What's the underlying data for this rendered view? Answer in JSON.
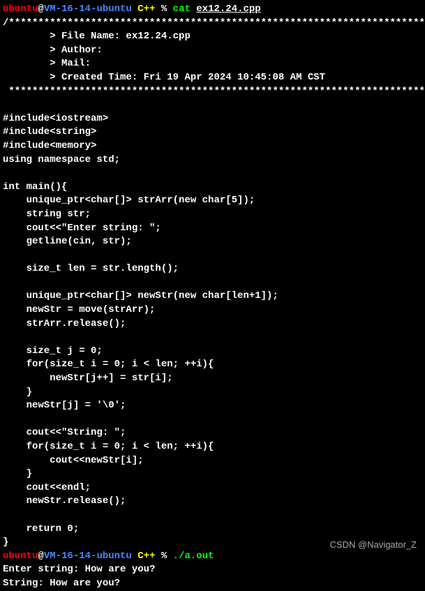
{
  "prompt1": {
    "user": "ubuntu",
    "at": "@",
    "host": "VM-16-14-ubuntu",
    "dir": " C++",
    "pct": " %",
    "cmd": " cat ",
    "file": "ex12.24.cpp"
  },
  "header": {
    "open": "/*************************************************************************",
    "file_line": "        > File Name: ex12.24.cpp",
    "author_line": "        > Author: ",
    "mail_line": "        > Mail: ",
    "created_line": "        > Created Time: Fri 19 Apr 2024 10:45:08 AM CST",
    "close": " ************************************************************************/"
  },
  "code": {
    "l1": "#include<iostream>",
    "l2": "#include<string>",
    "l3": "#include<memory>",
    "l4": "using namespace std;",
    "l5": "int main(){",
    "l6": "    unique_ptr<char[]> strArr(new char[5]);",
    "l7": "    string str;",
    "l8": "    cout<<\"Enter string: \";",
    "l9": "    getline(cin, str);",
    "l10": "    size_t len = str.length();",
    "l11": "    unique_ptr<char[]> newStr(new char[len+1]);",
    "l12": "    newStr = move(strArr);",
    "l13": "    strArr.release();",
    "l14": "    size_t j = 0;",
    "l15": "    for(size_t i = 0; i < len; ++i){",
    "l16": "        newStr[j++] = str[i];",
    "l17": "    }",
    "l18": "    newStr[j] = '\\0';",
    "l19": "    cout<<\"String: \";",
    "l20": "    for(size_t i = 0; i < len; ++i){",
    "l21": "        cout<<newStr[i];",
    "l22": "    }",
    "l23": "    cout<<endl;",
    "l24": "    newStr.release();",
    "l25": "    return 0;",
    "l26": "}"
  },
  "prompt2": {
    "user": "ubuntu",
    "at": "@",
    "host": "VM-16-14-ubuntu",
    "dir": " C++",
    "pct": " %",
    "cmd": " ./a.out"
  },
  "output": {
    "enter": "Enter string: How are you?",
    "string": "String: How are you?"
  },
  "watermark": "CSDN @Navigator_Z"
}
